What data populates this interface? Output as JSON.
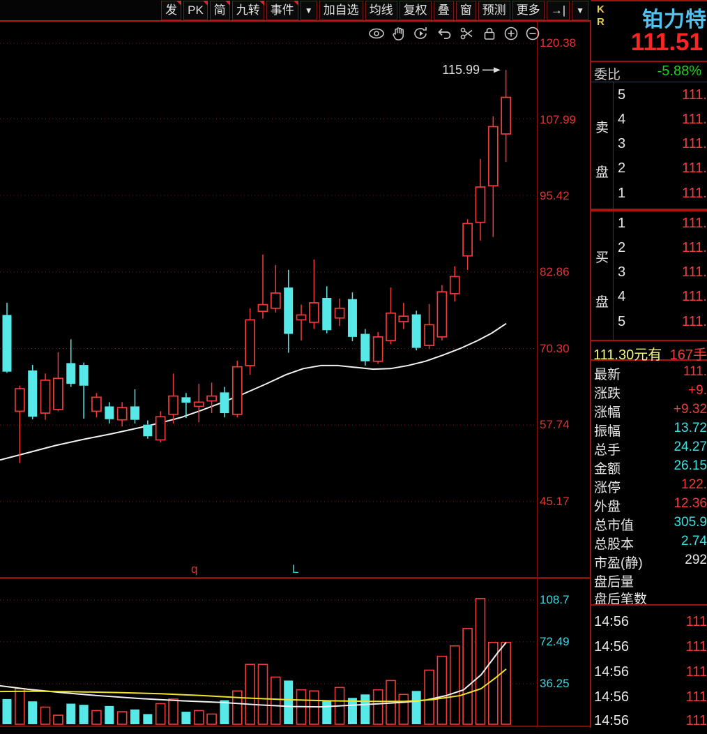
{
  "palette": {
    "red": "#f43b3b",
    "cyan": "#3ce0e0",
    "white": "#e8e8e8",
    "green": "#1fd01f",
    "yellow": "#f5f580"
  },
  "toolbar": {
    "items": [
      {
        "label": "发"
      },
      {
        "label": "PK"
      },
      {
        "label": "简"
      },
      {
        "label": "九转"
      },
      {
        "label": "事件"
      },
      {
        "label": "▼"
      },
      {
        "label": "加自选"
      },
      {
        "label": "均线"
      },
      {
        "label": "复权"
      },
      {
        "label": "叠"
      },
      {
        "label": "窗"
      },
      {
        "label": "预测"
      },
      {
        "label": "更多"
      },
      {
        "label": "→|"
      },
      {
        "label": "▼"
      }
    ]
  },
  "main_chart": {
    "price_axis": [
      "120.38",
      "107.99",
      "95.42",
      "82.86",
      "70.30",
      "57.74",
      "45.17"
    ],
    "volume_axis": [
      "108.7",
      "72.49",
      "36.25"
    ],
    "annotation": "115.99",
    "marker_q": "q",
    "marker_l": "L"
  },
  "chart_data": {
    "type": "candlestick",
    "title": "铂力特 K线 (daily)",
    "price_axis_values": [
      120.38,
      107.99,
      95.42,
      82.86,
      70.3,
      57.74,
      45.17
    ],
    "volume_axis_values": [
      108.7,
      72.49,
      36.25
    ],
    "annotation_high": 115.99,
    "last_close": 111.51,
    "candles_ohlc": [
      [
        75.8,
        77.8,
        66.3,
        66.5
      ],
      [
        60.0,
        64.2,
        51.5,
        63.7
      ],
      [
        66.7,
        67.6,
        58.7,
        59.1
      ],
      [
        59.7,
        66.2,
        58.6,
        65.1
      ],
      [
        60.3,
        69.7,
        60.0,
        65.4
      ],
      [
        67.9,
        71.8,
        64.0,
        64.5
      ],
      [
        67.6,
        68.0,
        58.8,
        64.2
      ],
      [
        60.0,
        63.0,
        59.0,
        62.3
      ],
      [
        60.8,
        61.5,
        58.0,
        58.7
      ],
      [
        58.6,
        61.5,
        57.5,
        60.6
      ],
      [
        60.8,
        63.6,
        58.0,
        58.6
      ],
      [
        57.8,
        58.5,
        55.5,
        55.9
      ],
      [
        55.3,
        60.0,
        54.9,
        59.1
      ],
      [
        59.5,
        66.2,
        58.0,
        62.5
      ],
      [
        62.3,
        63.0,
        58.9,
        61.4
      ],
      [
        60.8,
        64.5,
        58.2,
        61.5
      ],
      [
        61.7,
        64.7,
        59.7,
        62.5
      ],
      [
        63.1,
        64.0,
        59.0,
        59.7
      ],
      [
        59.5,
        68.3,
        59.0,
        67.3
      ],
      [
        67.5,
        76.9,
        66.0,
        75.0
      ],
      [
        76.4,
        85.7,
        75.2,
        77.5
      ],
      [
        76.9,
        84.0,
        76.2,
        79.4
      ],
      [
        80.3,
        83.2,
        69.6,
        72.7
      ],
      [
        75.0,
        77.5,
        71.6,
        75.8
      ],
      [
        74.6,
        84.9,
        73.5,
        77.8
      ],
      [
        78.6,
        80.5,
        72.8,
        73.3
      ],
      [
        75.3,
        78.5,
        74.0,
        76.9
      ],
      [
        78.4,
        79.5,
        71.5,
        72.2
      ],
      [
        72.7,
        73.5,
        67.5,
        68.2
      ],
      [
        68.2,
        73.0,
        67.8,
        72.2
      ],
      [
        71.6,
        80.3,
        71.0,
        76.1
      ],
      [
        74.7,
        77.8,
        73.5,
        75.6
      ],
      [
        75.9,
        76.5,
        70.0,
        70.4
      ],
      [
        70.8,
        77.6,
        70.2,
        74.2
      ],
      [
        72.2,
        80.7,
        71.6,
        79.6
      ],
      [
        79.3,
        83.8,
        78.0,
        82.1
      ],
      [
        85.5,
        91.5,
        83.2,
        90.8
      ],
      [
        91.0,
        101.4,
        88.0,
        96.8
      ],
      [
        97.0,
        108.4,
        88.6,
        106.7
      ],
      [
        105.5,
        115.99,
        100.9,
        111.51
      ]
    ],
    "volumes": [
      23,
      32,
      21,
      16,
      9,
      19,
      18,
      13,
      17,
      12,
      14,
      10,
      19,
      23,
      12,
      13,
      10,
      22,
      30,
      53,
      53,
      42,
      39,
      31,
      30,
      22,
      33,
      24,
      27,
      31,
      39,
      27,
      30,
      48,
      60,
      69,
      84,
      110,
      72,
      72
    ],
    "ma_price_white": [
      [
        0,
        52.0
      ],
      [
        40,
        53.2
      ],
      [
        80,
        54.4
      ],
      [
        120,
        55.4
      ],
      [
        160,
        56.3
      ],
      [
        200,
        57.3
      ],
      [
        230,
        58.1
      ],
      [
        260,
        59.0
      ],
      [
        290,
        60.2
      ],
      [
        320,
        61.5
      ],
      [
        350,
        62.9
      ],
      [
        380,
        64.4
      ],
      [
        410,
        66.0
      ],
      [
        435,
        67.0
      ],
      [
        460,
        67.5
      ],
      [
        485,
        67.5
      ],
      [
        510,
        67.2
      ],
      [
        535,
        66.9
      ],
      [
        560,
        67.0
      ],
      [
        585,
        67.5
      ],
      [
        610,
        68.2
      ],
      [
        635,
        69.2
      ],
      [
        660,
        70.3
      ],
      [
        685,
        71.6
      ],
      [
        705,
        72.8
      ],
      [
        726,
        74.4
      ]
    ],
    "vol_ma_white": [
      [
        0,
        34.5
      ],
      [
        40,
        31.5
      ],
      [
        90,
        28.5
      ],
      [
        140,
        26.0
      ],
      [
        200,
        23.5
      ],
      [
        260,
        21.5
      ],
      [
        320,
        20.0
      ],
      [
        370,
        18.0
      ],
      [
        420,
        16.5
      ],
      [
        460,
        16.2
      ],
      [
        500,
        17.5
      ],
      [
        540,
        18.8
      ],
      [
        580,
        20.2
      ],
      [
        610,
        22.0
      ],
      [
        640,
        26.0
      ],
      [
        665,
        31.0
      ],
      [
        690,
        44.0
      ],
      [
        705,
        56.0
      ],
      [
        715,
        64.0
      ],
      [
        726,
        72.0
      ]
    ],
    "vol_ma_yellow": [
      [
        0,
        29.5
      ],
      [
        50,
        29.8
      ],
      [
        110,
        29.3
      ],
      [
        170,
        28.6
      ],
      [
        230,
        27.6
      ],
      [
        290,
        26.0
      ],
      [
        350,
        24.0
      ],
      [
        410,
        22.5
      ],
      [
        470,
        21.5
      ],
      [
        530,
        21.0
      ],
      [
        580,
        21.0
      ],
      [
        620,
        22.5
      ],
      [
        660,
        26.0
      ],
      [
        690,
        32.0
      ],
      [
        710,
        41.0
      ],
      [
        726,
        49.0
      ]
    ],
    "colors": {
      "up": "#f43b3b",
      "down": "#57e8e8",
      "ma_white": "#f2f2f2",
      "ma_yellow": "#efe42a",
      "grid": "#7a2020"
    }
  },
  "right_panel": {
    "indicator_k": "K",
    "indicator_r": "R",
    "stock_name": "铂力特",
    "last_price": "111.51",
    "weibi_label": "委比",
    "weibi_value": "-5.88%",
    "sell_label": "卖盘",
    "buy_label": "买盘",
    "sell_rows": [
      {
        "level": "5",
        "price": "111."
      },
      {
        "level": "4",
        "price": "111."
      },
      {
        "level": "3",
        "price": "111."
      },
      {
        "level": "2",
        "price": "111."
      },
      {
        "level": "1",
        "price": "111."
      }
    ],
    "buy_rows": [
      {
        "level": "1",
        "price": "111."
      },
      {
        "level": "2",
        "price": "111."
      },
      {
        "level": "3",
        "price": "111."
      },
      {
        "level": "4",
        "price": "111."
      },
      {
        "level": "5",
        "price": "111."
      }
    ],
    "quote_price": "111.30元有",
    "quote_vol": "167手",
    "stats": [
      {
        "label": "最新",
        "value": "111.",
        "color": "red"
      },
      {
        "label": "涨跌",
        "value": "+9.",
        "color": "red"
      },
      {
        "label": "涨幅",
        "value": "+9.32",
        "color": "red"
      },
      {
        "label": "振幅",
        "value": "13.72",
        "color": "cyan"
      },
      {
        "label": "总手",
        "value": "24.27",
        "color": "cyan"
      },
      {
        "label": "金额",
        "value": "26.15",
        "color": "cyan"
      },
      {
        "label": "涨停",
        "value": "122.",
        "color": "red"
      },
      {
        "label": "外盘",
        "value": "12.36",
        "color": "red"
      },
      {
        "label": "总市值",
        "value": "305.9",
        "color": "cyan"
      },
      {
        "label": "总股本",
        "value": "2.74",
        "color": "cyan"
      },
      {
        "label": "市盈(静)",
        "value": "292",
        "color": "white"
      },
      {
        "label": "盘后量",
        "value": "",
        "color": "white"
      },
      {
        "label": "盘后笔数",
        "value": "",
        "color": "white"
      }
    ],
    "ticks": [
      {
        "time": "14:56",
        "price": "111"
      },
      {
        "time": "14:56",
        "price": "111"
      },
      {
        "time": "14:56",
        "price": "111"
      },
      {
        "time": "14:56",
        "price": "111"
      },
      {
        "time": "14:56",
        "price": "111"
      }
    ]
  }
}
